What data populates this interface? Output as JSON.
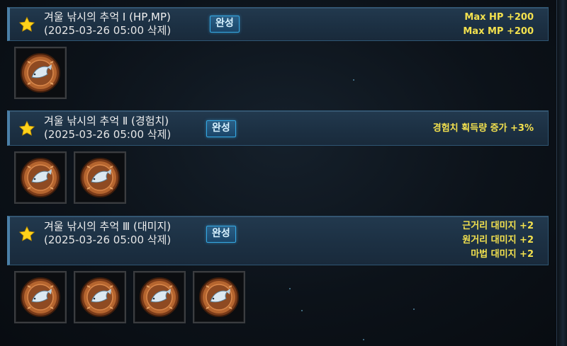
{
  "sets": [
    {
      "title": "겨울 낚시의 추억 Ⅰ (HP,MP)",
      "date": "(2025-03-26 05:00 삭제)",
      "status": "완성",
      "bonuses": [
        "Max HP +200",
        "Max MP +200"
      ],
      "items": [
        "winter-fish-medal",
        ""
      ]
    },
    {
      "title": "겨울 낚시의 추억 Ⅱ (경험치)",
      "date": "(2025-03-26 05:00 삭제)",
      "status": "완성",
      "bonuses": [
        "경험치 획득량 증가 +3%"
      ],
      "items": [
        "winter-fish-medal",
        "winter-fish-medal"
      ]
    },
    {
      "title": "겨울 낚시의 추억 Ⅲ (대미지)",
      "date": "(2025-03-26 05:00 삭제)",
      "status": "완성",
      "bonuses": [
        "근거리 대미지 +2",
        "원거리 대미지 +2",
        "마법 대미지 +2"
      ],
      "items": [
        "winter-fish-medal",
        "winter-fish-medal",
        "winter-fish-medal",
        "winter-fish-medal"
      ]
    }
  ],
  "colors": {
    "bonus_text": "#f3e14e",
    "badge_border": "#35a9e4",
    "header_bg": "#1c3043",
    "medal": "#b5652f"
  },
  "icons": {
    "set_marker": "star-icon",
    "item": "fish-medal-icon"
  }
}
